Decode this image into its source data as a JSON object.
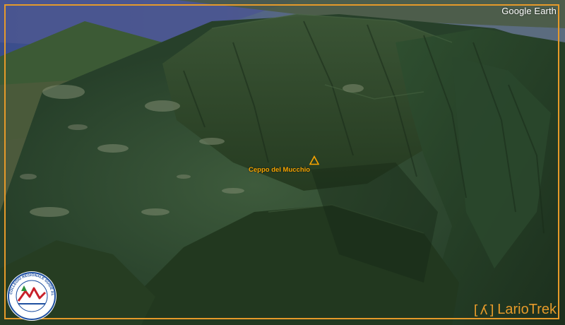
{
  "brand": "Google Earth",
  "peak": {
    "name": "Ceppo del Mucchio"
  },
  "logo": {
    "symbol": "[ʎ]",
    "name": "LarioTrek"
  },
  "seal": {
    "text": "COLLEGIO REGIONALE GUIDE ALPINE LOMBARDIA"
  },
  "colors": {
    "frame": "#e69a2a",
    "marker": "#f6a300",
    "forest": "#2a4a2e",
    "lake": "#3b4a8a"
  },
  "icons": {
    "marker": "triangle-peak-icon",
    "seal": "guide-alpine-seal-icon"
  }
}
